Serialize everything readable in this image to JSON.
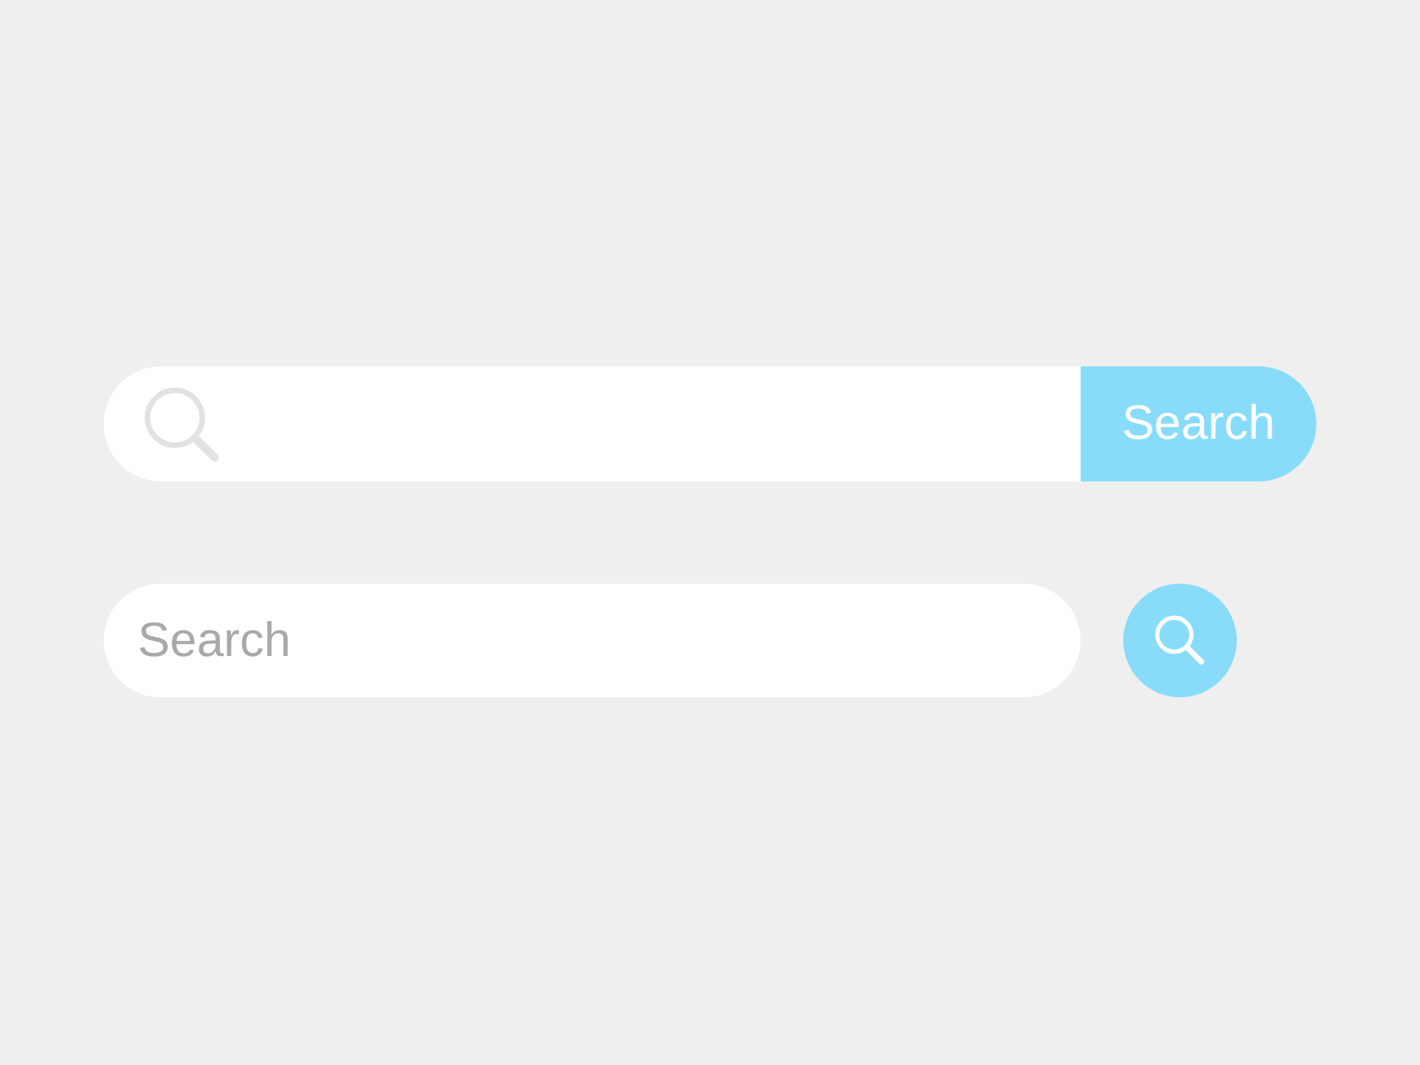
{
  "search_bar_with_button": {
    "button": "Search"
  },
  "search_bar_with_round_button": {
    "placeholder": "Search"
  }
}
